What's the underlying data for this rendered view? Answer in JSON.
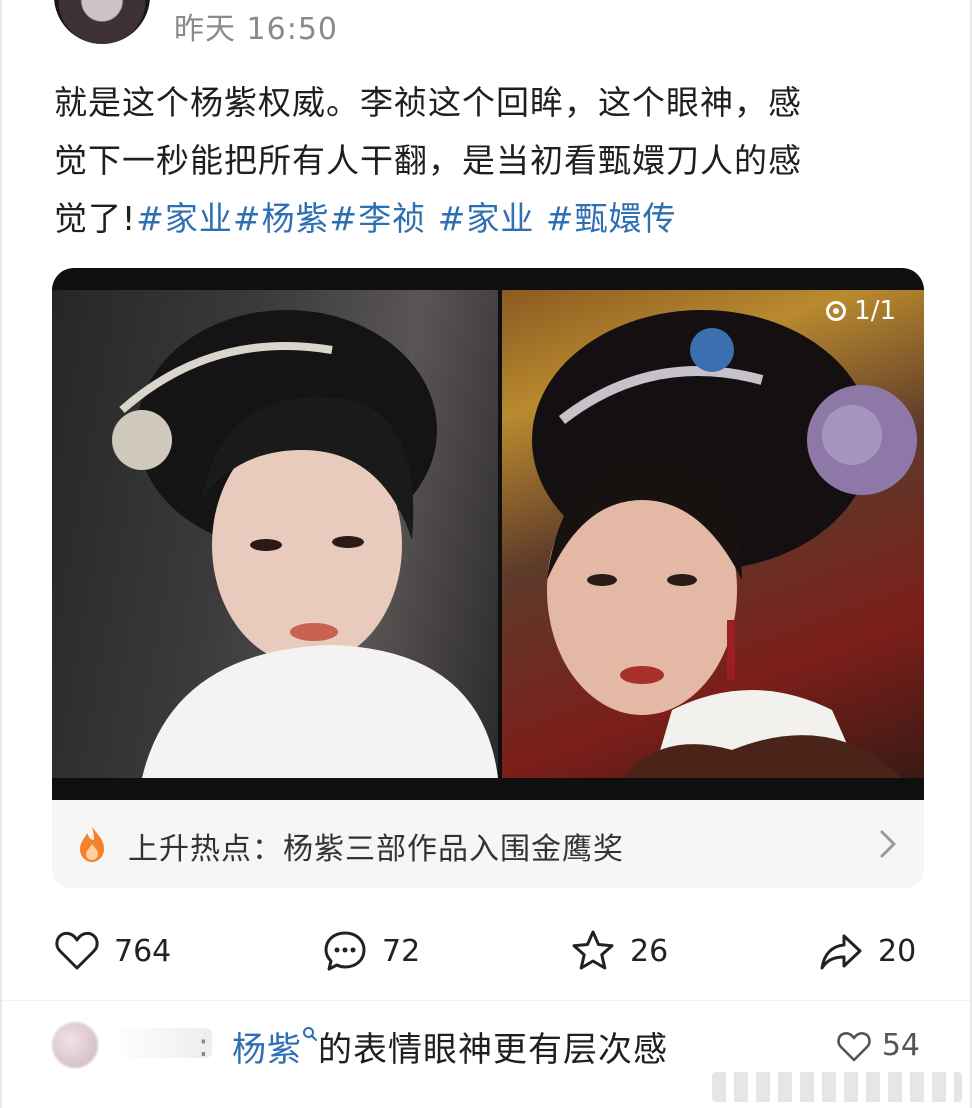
{
  "post": {
    "timestamp": "昨天 16:50",
    "text_line_1": "就是这个杨紫权威。李祯这个回眸，这个眼神，感",
    "text_line_2": "觉下一秒能把所有人干翻，是当初看甄嬛刀人的感",
    "text_line_3_plain": "觉了!",
    "hashtags": [
      "#家业",
      "#杨紫",
      "#李祯 ",
      "#家业 ",
      "#甄嬛传"
    ]
  },
  "image": {
    "counter": "1/1"
  },
  "trending": {
    "text": "上升热点：杨紫三部作品入围金鹰奖"
  },
  "actions": {
    "like_count": "764",
    "comment_count": "72",
    "favorite_count": "26",
    "share_count": "20"
  },
  "comment": {
    "colon": ":",
    "mention": "杨紫",
    "text": "的表情眼神更有层次感",
    "like_count": "54"
  },
  "colors": {
    "hashtag": "#2f6fb3",
    "trend_flame": "#f5812a",
    "muted_text": "#8a8a8a"
  },
  "icons": [
    "heart-icon",
    "comment-icon",
    "star-icon",
    "share-icon",
    "flame-icon",
    "chevron-right-icon",
    "search-icon",
    "image-count-icon"
  ]
}
